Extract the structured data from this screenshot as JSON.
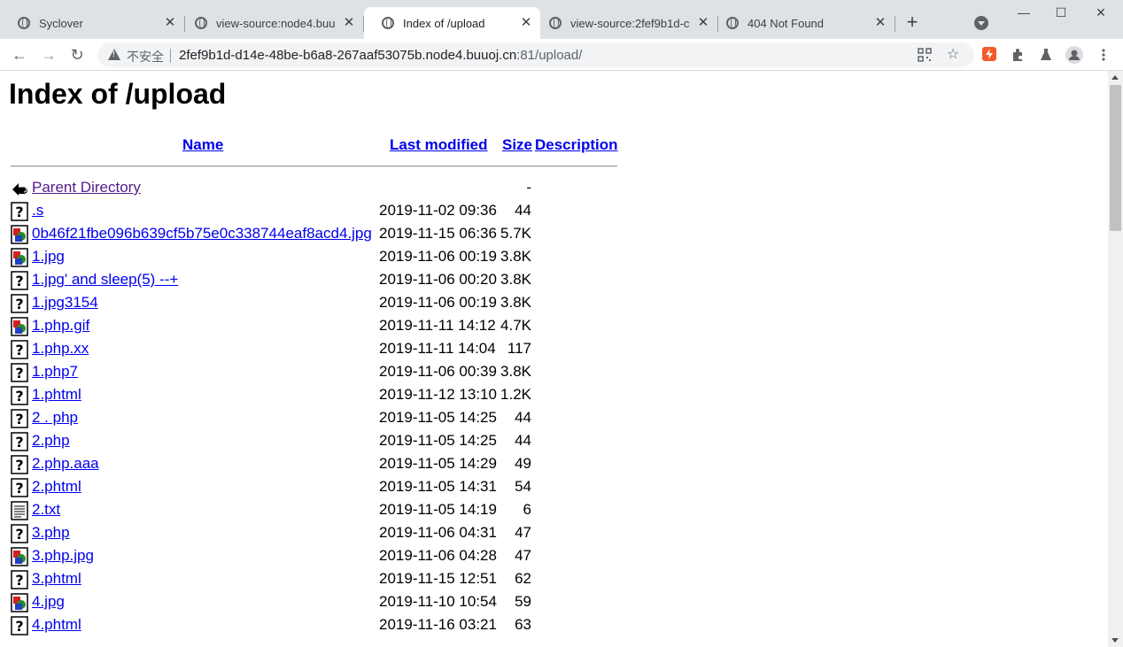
{
  "browser": {
    "tabs": [
      {
        "title": "Syclover",
        "active": false
      },
      {
        "title": "view-source:node4.buu",
        "active": false
      },
      {
        "title": "Index of /upload",
        "active": true
      },
      {
        "title": "view-source:2fef9b1d-c",
        "active": false
      },
      {
        "title": "404 Not Found",
        "active": false
      }
    ],
    "security_label": "不安全",
    "url_host": "2fef9b1d-d14e-48be-b6a8-267aaf53075b.node4.buuoj.cn",
    "url_port_path": ":81/upload/"
  },
  "page": {
    "heading": "Index of /upload",
    "columns": {
      "name": "Name",
      "last_modified": "Last modified",
      "size": "Size",
      "description": "Description"
    },
    "rows": [
      {
        "icon": "back-icon",
        "name": "Parent Directory",
        "date": "",
        "size": "-",
        "visited": true
      },
      {
        "icon": "unknown-file-icon",
        "name": ".s",
        "date": "2019-11-02 09:36",
        "size": "44"
      },
      {
        "icon": "image-file-icon",
        "name": "0b46f21fbe096b639cf5b75e0c338744eaf8acd4.jpg",
        "date": "2019-11-15 06:36",
        "size": "5.7K"
      },
      {
        "icon": "image-file-icon",
        "name": "1.jpg",
        "date": "2019-11-06 00:19",
        "size": "3.8K"
      },
      {
        "icon": "unknown-file-icon",
        "name": "1.jpg' and sleep(5) --+",
        "date": "2019-11-06 00:20",
        "size": "3.8K"
      },
      {
        "icon": "unknown-file-icon",
        "name": "1.jpg3154",
        "date": "2019-11-06 00:19",
        "size": "3.8K"
      },
      {
        "icon": "image-file-icon",
        "name": "1.php.gif",
        "date": "2019-11-11 14:12",
        "size": "4.7K"
      },
      {
        "icon": "unknown-file-icon",
        "name": "1.php.xx",
        "date": "2019-11-11 14:04",
        "size": "117"
      },
      {
        "icon": "unknown-file-icon",
        "name": "1.php7",
        "date": "2019-11-06 00:39",
        "size": "3.8K"
      },
      {
        "icon": "unknown-file-icon",
        "name": "1.phtml",
        "date": "2019-11-12 13:10",
        "size": "1.2K"
      },
      {
        "icon": "unknown-file-icon",
        "name": "2 . php",
        "date": "2019-11-05 14:25",
        "size": "44"
      },
      {
        "icon": "unknown-file-icon",
        "name": "2.php",
        "date": "2019-11-05 14:25",
        "size": "44"
      },
      {
        "icon": "unknown-file-icon",
        "name": "2.php.aaa",
        "date": "2019-11-05 14:29",
        "size": "49"
      },
      {
        "icon": "unknown-file-icon",
        "name": "2.phtml",
        "date": "2019-11-05 14:31",
        "size": "54"
      },
      {
        "icon": "text-file-icon",
        "name": "2.txt",
        "date": "2019-11-05 14:19",
        "size": "6"
      },
      {
        "icon": "unknown-file-icon",
        "name": "3.php",
        "date": "2019-11-06 04:31",
        "size": "47"
      },
      {
        "icon": "image-file-icon",
        "name": "3.php.jpg",
        "date": "2019-11-06 04:28",
        "size": "47"
      },
      {
        "icon": "unknown-file-icon",
        "name": "3.phtml",
        "date": "2019-11-15 12:51",
        "size": "62"
      },
      {
        "icon": "image-file-icon",
        "name": "4.jpg",
        "date": "2019-11-10 10:54",
        "size": "59"
      },
      {
        "icon": "unknown-file-icon",
        "name": "4.phtml",
        "date": "2019-11-16 03:21",
        "size": "63"
      }
    ]
  },
  "colors": {
    "link": "#0000ee",
    "visited": "#551a8b",
    "tabstrip": "#dee1e6",
    "omnibox": "#f1f3f4"
  }
}
